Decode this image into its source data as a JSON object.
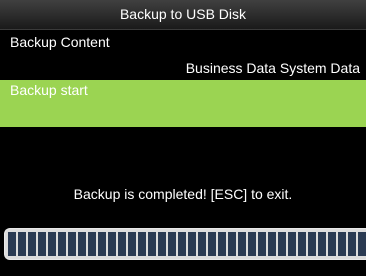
{
  "window": {
    "title": "Backup to USB Disk"
  },
  "backup_content": {
    "label": "Backup Content",
    "value": "Business Data System Data"
  },
  "backup_start": {
    "label": "Backup start",
    "highlight_color": "#9bd452"
  },
  "status": {
    "message": "Backup is completed! [ESC] to exit."
  },
  "progress": {
    "fraction": 1.0
  }
}
